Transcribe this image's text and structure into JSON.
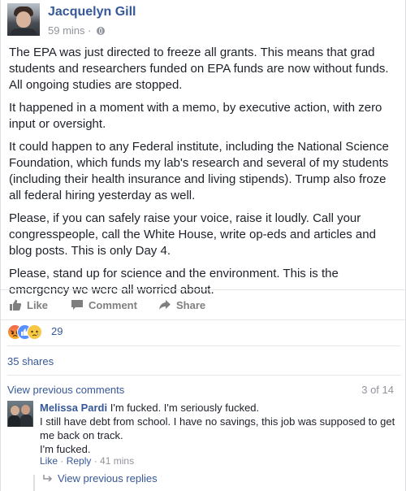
{
  "post": {
    "author": "Jacquelyn Gill",
    "time": "59 mins",
    "time_sep": " · ",
    "paragraphs": [
      "The EPA was just directed to freeze all grants. This means that grad students and researchers funded on EPA funds are now without funds. All ongoing studies are stopped.",
      "It happened in a moment with a memo, by executive action, with zero input or oversight.",
      "It could happen to any Federal institute, including the National Science Foundation, which funds my lab's research and several of my students (including their health insurance and living stipends). Trump also froze all federal hiring yesterday as well.",
      "Please, if you can safely raise your voice, raise it loudly. Call your congresspeople, call the White House, write op-eds and articles and blog posts. This is only Day 4.",
      "Please, stand up for science and the environment. This is the emergency we were all worried about."
    ]
  },
  "actions": {
    "like": "Like",
    "comment": "Comment",
    "share": "Share"
  },
  "reactions": {
    "count": "29",
    "types": [
      "angry-icon",
      "like-icon",
      "sad-icon"
    ]
  },
  "shares": "35 shares",
  "comments": {
    "view_previous": "View previous comments",
    "count_of": "3 of 14",
    "items": [
      {
        "name": "Melissa Pardi",
        "lines": [
          "I'm fucked. I'm seriously fucked.",
          "I still have debt from school. I have no savings, this job was supposed to get me back on track.",
          "I'm fucked."
        ],
        "like": "Like",
        "reply": "Reply",
        "time": "41 mins",
        "sep": " · "
      }
    ],
    "view_previous_replies": "View previous replies"
  },
  "colors": {
    "link": "#365899",
    "meta": "#90949c",
    "text": "#1d2129",
    "action": "#7f7f7f"
  }
}
